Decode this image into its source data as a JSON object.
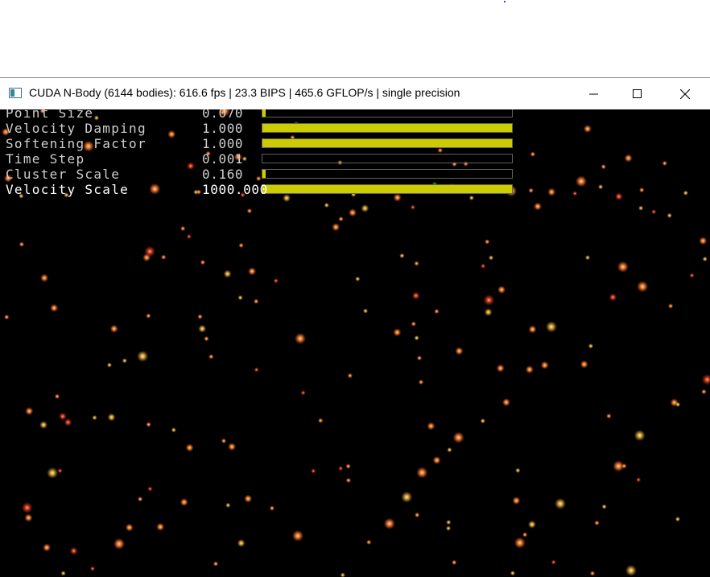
{
  "window": {
    "title": "CUDA N-Body (6144 bodies): 616.6 fps | 23.3 BIPS | 465.6 GFLOP/s | single precision",
    "icon": "app-window-icon",
    "controls": {
      "minimize": "minimize-icon",
      "maximize": "maximize-icon",
      "close": "close-icon"
    }
  },
  "params": [
    {
      "label": "Point Size",
      "value": "0.070",
      "fill": 0.01,
      "active": false
    },
    {
      "label": "Velocity Damping",
      "value": "1.000",
      "fill": 1.0,
      "active": false
    },
    {
      "label": "Softening Factor",
      "value": "1.000",
      "fill": 1.0,
      "active": false
    },
    {
      "label": "Time Step",
      "value": "0.001",
      "fill": 0.0,
      "active": false
    },
    {
      "label": "Cluster Scale",
      "value": "0.160",
      "fill": 0.016,
      "active": false
    },
    {
      "label": "Velocity Scale",
      "value": "1000.000",
      "fill": 1.0,
      "active": true
    }
  ],
  "colors": {
    "slider_fill": "#cccc00",
    "slider_border": "#606060",
    "background": "#000000"
  }
}
